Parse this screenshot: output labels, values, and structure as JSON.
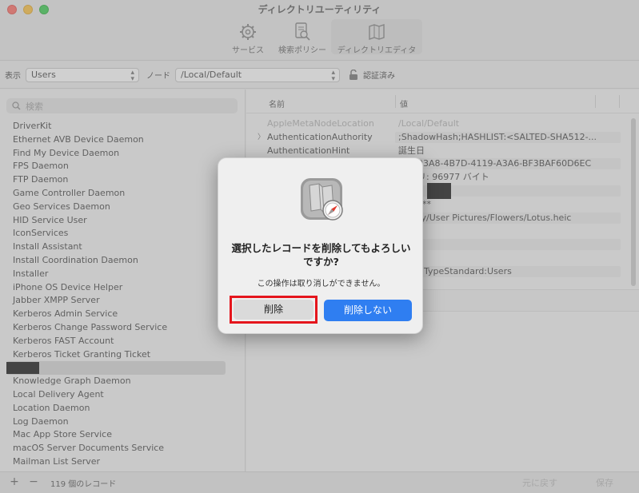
{
  "window": {
    "title": "ディレクトリユーティリティ",
    "tabs": [
      {
        "label": "サービス",
        "icon": "gear-icon"
      },
      {
        "label": "検索ポリシー",
        "icon": "search-policy-icon"
      },
      {
        "label": "ディレクトリエディタ",
        "icon": "map-icon"
      }
    ]
  },
  "filter": {
    "view_label": "表示",
    "view_value": "Users",
    "node_label": "ノード",
    "node_value": "/Local/Default",
    "auth_label": "認証済み"
  },
  "sidebar": {
    "search_placeholder": "検索",
    "items": [
      "DriverKit",
      "Ethernet AVB Device Daemon",
      "Find My Device Daemon",
      "FPS Daemon",
      "FTP Daemon",
      "Game Controller Daemon",
      "Geo Services Daemon",
      "HID Service User",
      "IconServices",
      "Install Assistant",
      "Install Coordination Daemon",
      "Installer",
      "iPhone OS Device Helper",
      "Jabber XMPP Server",
      "Kerberos Admin Service",
      "Kerberos Change Password Service",
      "Kerberos FAST Account",
      "Kerberos Ticket Granting Ticket",
      "",
      "Knowledge Graph Daemon",
      "Local Delivery Agent",
      "Location Daemon",
      "Log Daemon",
      "Mac App Store Service",
      "macOS Server Documents Service",
      "Mailman List Server"
    ]
  },
  "detail": {
    "col_name": "名前",
    "col_value": "値",
    "rows": [
      {
        "key": "AppleMetaNodeLocation",
        "value": "/Local/Default"
      },
      {
        "key": "AuthenticationAuthority",
        "value": ";ShadowHash;HASHLIST:<SALTED-SHA512-..."
      },
      {
        "key": "AuthenticationHint",
        "value": "誕生日"
      },
      {
        "key": "",
        "value": "93A8-4B7D-4119-A3A6-BF3BAF60D6EC"
      },
      {
        "key": "",
        "value": "リ: 96977 バイト"
      },
      {
        "key": "",
        "value": ""
      },
      {
        "key": "",
        "value": "**"
      },
      {
        "key": "",
        "value": "ry/User Pictures/Flowers/Lotus.heic"
      },
      {
        "key": "",
        "value": ""
      },
      {
        "key": "",
        "value": ""
      },
      {
        "key": "",
        "value": ""
      },
      {
        "key": "",
        "value": "TypeStandard:Users"
      }
    ]
  },
  "bottombar": {
    "add": "+",
    "remove": "−",
    "count": "119 個のレコード",
    "revert": "元に戻す",
    "save": "保存"
  },
  "dialog": {
    "title": "選択したレコードを削除してもよろしいですか?",
    "message": "この操作は取り消しができません。",
    "delete_label": "削除",
    "keep_label": "削除しない",
    "accent": "#2f7ef1",
    "highlight": "#e5161d"
  }
}
